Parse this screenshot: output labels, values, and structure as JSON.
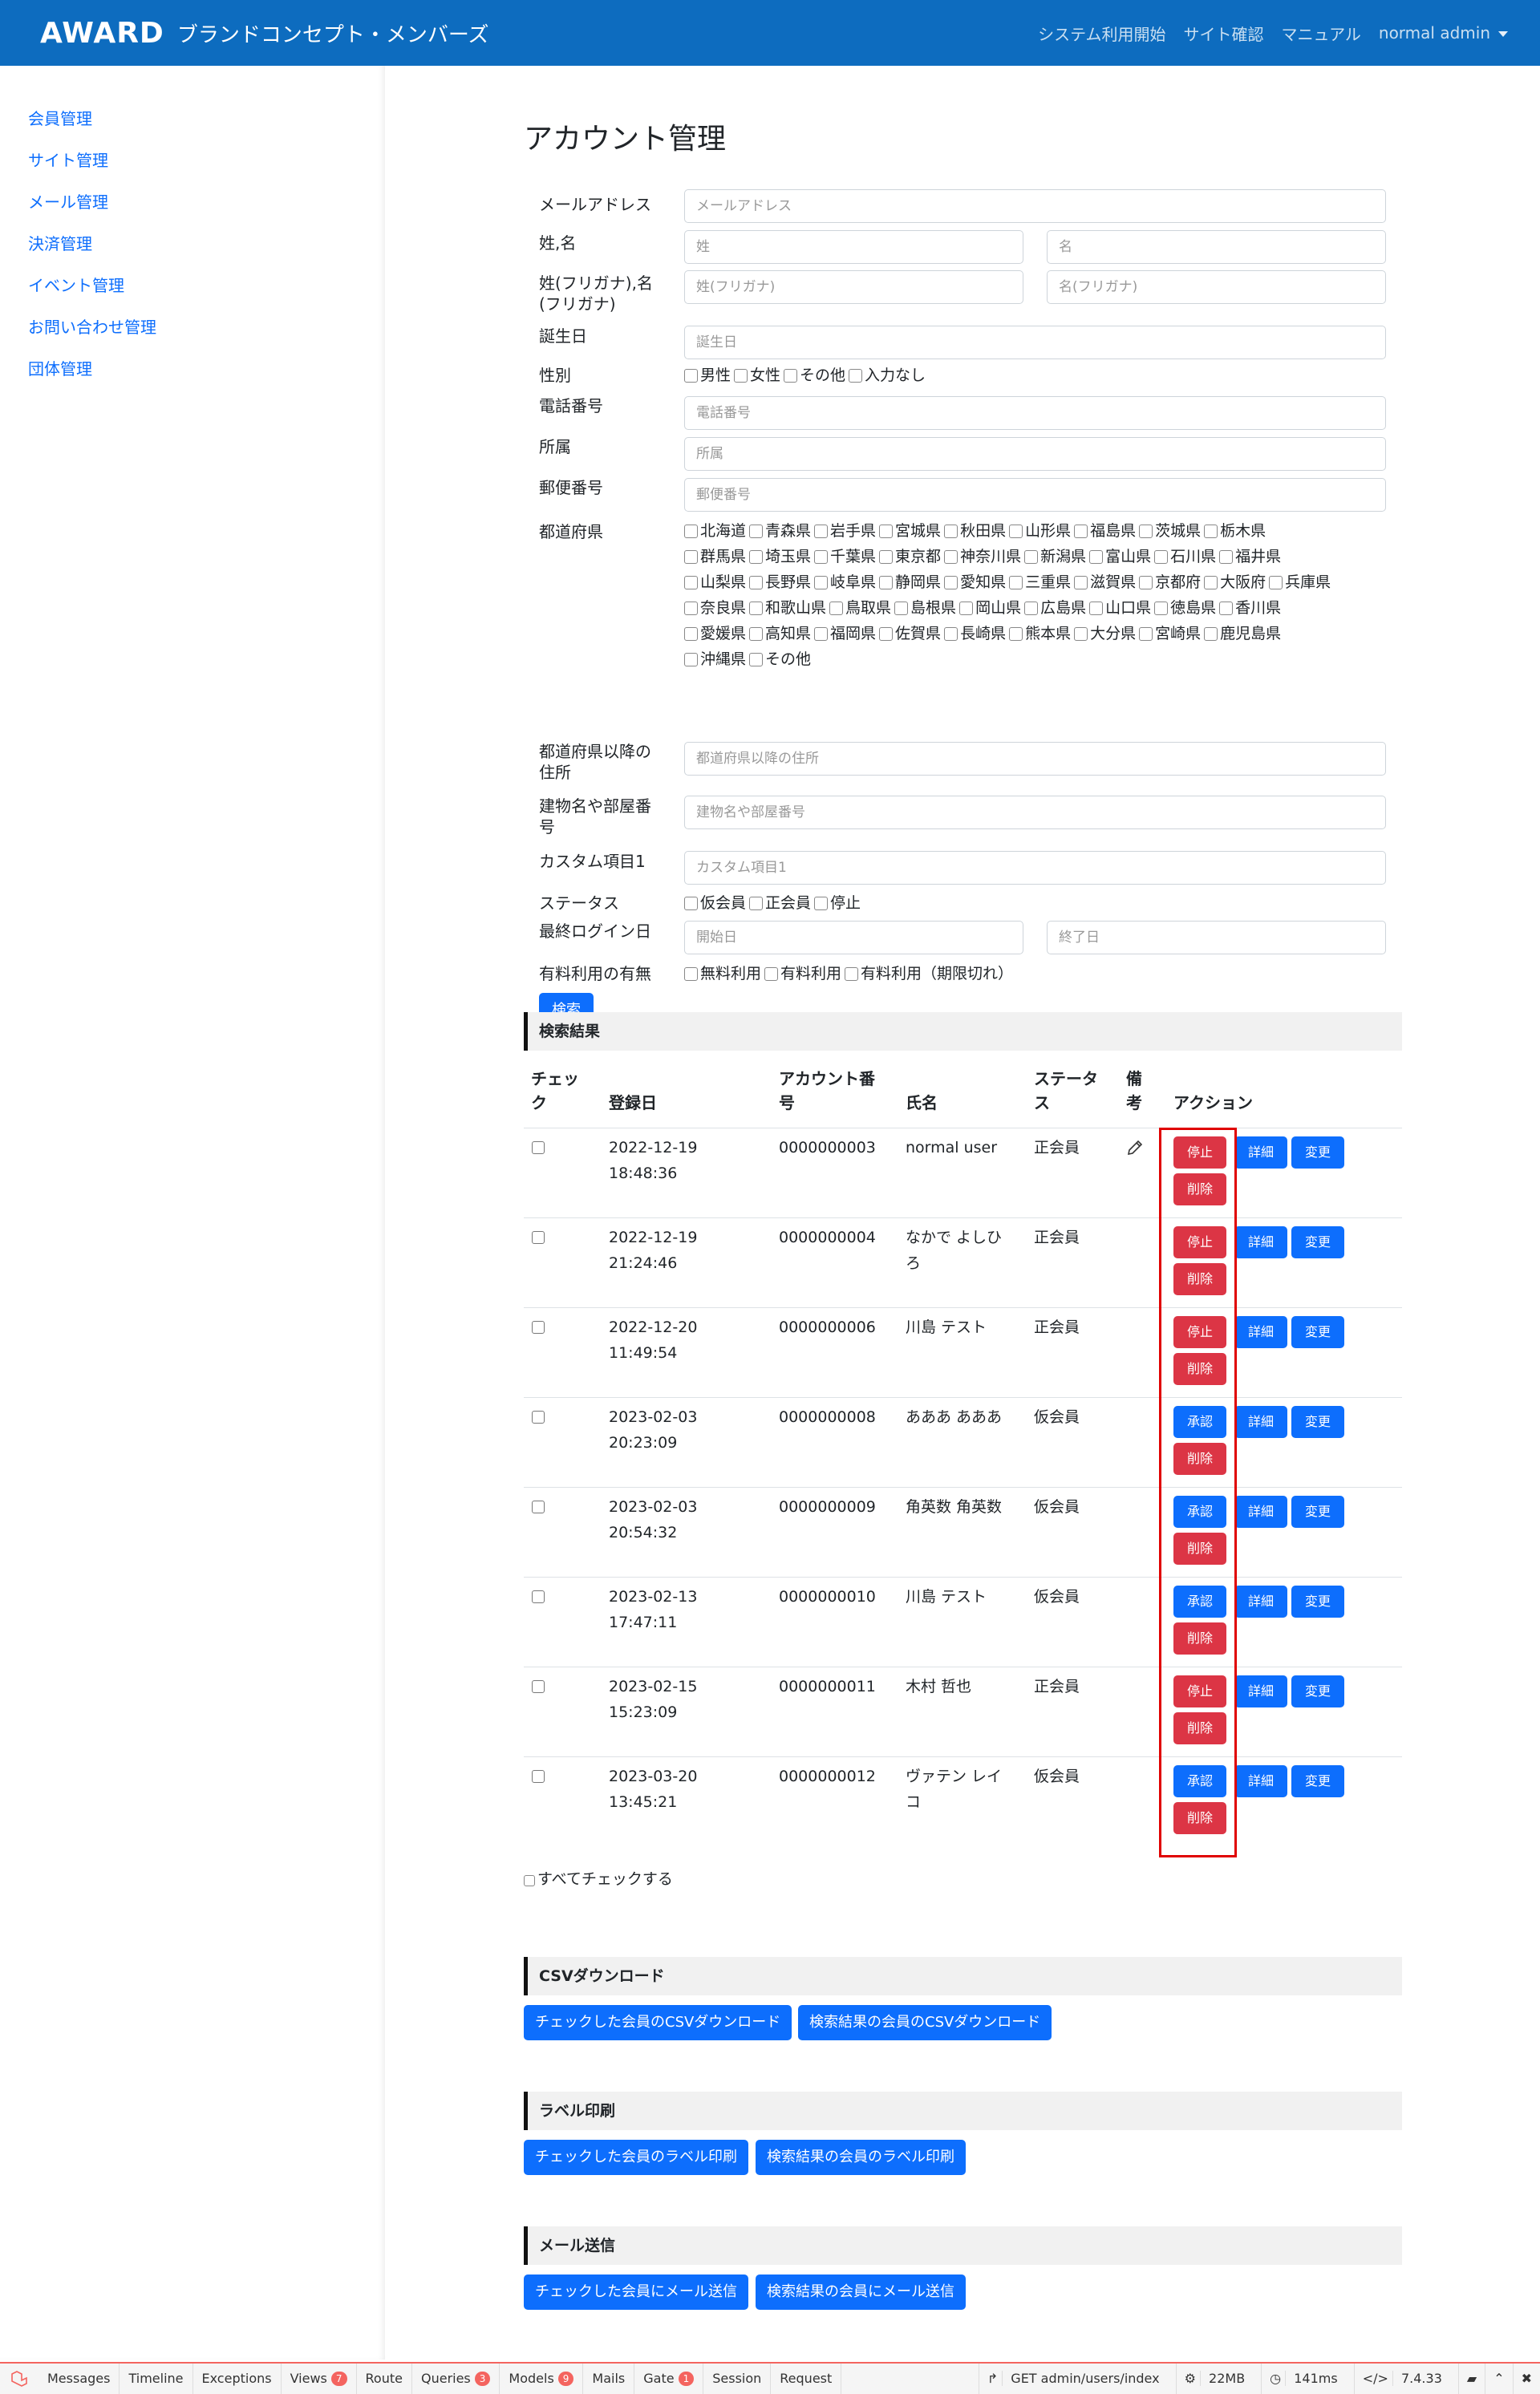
{
  "brand": {
    "logo": "AWARD",
    "subtitle": "ブランドコンセプト・メンバーズ"
  },
  "nav": {
    "links": [
      "システム利用開始",
      "サイト確認",
      "マニュアル"
    ],
    "user": "normal admin"
  },
  "sidebar": {
    "items": [
      "会員管理",
      "サイト管理",
      "メール管理",
      "決済管理",
      "イベント管理",
      "お問い合わせ管理",
      "団体管理"
    ]
  },
  "page": {
    "title": "アカウント管理"
  },
  "form": {
    "email": {
      "label": "メールアドレス",
      "placeholder": "メールアドレス"
    },
    "name": {
      "label": "姓,名",
      "last": "姓",
      "first": "名"
    },
    "kana": {
      "label1": "姓(フリガナ),名",
      "label2": "(フリガナ)",
      "last": "姓(フリガナ)",
      "first": "名(フリガナ)"
    },
    "birthday": {
      "label": "誕生日",
      "placeholder": "誕生日"
    },
    "gender": {
      "label": "性別",
      "options": [
        "男性",
        "女性",
        "その他",
        "入力なし"
      ]
    },
    "phone": {
      "label": "電話番号",
      "placeholder": "電話番号"
    },
    "affiliation": {
      "label": "所属",
      "placeholder": "所属"
    },
    "zip": {
      "label": "郵便番号",
      "placeholder": "郵便番号"
    },
    "pref": {
      "label": "都道府県",
      "rows": [
        [
          "北海道",
          "青森県",
          "岩手県",
          "宮城県",
          "秋田県",
          "山形県",
          "福島県",
          "茨城県",
          "栃木県"
        ],
        [
          "群馬県",
          "埼玉県",
          "千葉県",
          "東京都",
          "神奈川県",
          "新潟県",
          "富山県",
          "石川県",
          "福井県"
        ],
        [
          "山梨県",
          "長野県",
          "岐阜県",
          "静岡県",
          "愛知県",
          "三重県",
          "滋賀県",
          "京都府",
          "大阪府",
          "兵庫県"
        ],
        [
          "奈良県",
          "和歌山県",
          "鳥取県",
          "島根県",
          "岡山県",
          "広島県",
          "山口県",
          "徳島県",
          "香川県"
        ],
        [
          "愛媛県",
          "高知県",
          "福岡県",
          "佐賀県",
          "長崎県",
          "熊本県",
          "大分県",
          "宮崎県",
          "鹿児島県"
        ],
        [
          "沖縄県",
          "その他"
        ]
      ]
    },
    "address": {
      "label1": "都道府県以降の",
      "label2": "住所",
      "placeholder": "都道府県以降の住所"
    },
    "building": {
      "label1": "建物名や部屋番",
      "label2": "号",
      "placeholder": "建物名や部屋番号"
    },
    "custom": {
      "label": "カスタム項目1",
      "placeholder": "カスタム項目1"
    },
    "status": {
      "label": "ステータス",
      "options": [
        "仮会員",
        "正会員",
        "停止"
      ]
    },
    "login": {
      "label": "最終ログイン日",
      "start": "開始日",
      "end": "終了日"
    },
    "paid": {
      "label": "有料利用の有無",
      "options": [
        "無料利用",
        "有料利用",
        "有料利用（期限切れ）"
      ]
    },
    "search_button": "検索"
  },
  "results": {
    "heading": "検索結果",
    "headers": {
      "check1": "チェッ",
      "check2": "ク",
      "date": "登録日",
      "acc1": "アカウント番",
      "acc2": "号",
      "name": "氏名",
      "status1": "ステータ",
      "status2": "ス",
      "note1": "備",
      "note2": "考",
      "action": "アクション"
    },
    "rows": [
      {
        "date1": "2022-12-19",
        "date2": "18:48:36",
        "account": "0000000003",
        "name1": "normal user",
        "name2": "",
        "status": "正会員",
        "toggle": "停止",
        "edit_icon": true
      },
      {
        "date1": "2022-12-19",
        "date2": "21:24:46",
        "account": "0000000004",
        "name1": "なかで よしひ",
        "name2": "ろ",
        "status": "正会員",
        "toggle": "停止",
        "edit_icon": false
      },
      {
        "date1": "2022-12-20",
        "date2": "11:49:54",
        "account": "0000000006",
        "name1": "川島 テスト",
        "name2": "",
        "status": "正会員",
        "toggle": "停止",
        "edit_icon": false
      },
      {
        "date1": "2023-02-03",
        "date2": "20:23:09",
        "account": "0000000008",
        "name1": "あああ あああ",
        "name2": "",
        "status": "仮会員",
        "toggle": "承認",
        "edit_icon": false
      },
      {
        "date1": "2023-02-03",
        "date2": "20:54:32",
        "account": "0000000009",
        "name1": "角英数 角英数",
        "name2": "",
        "status": "仮会員",
        "toggle": "承認",
        "edit_icon": false
      },
      {
        "date1": "2023-02-13",
        "date2": "17:47:11",
        "account": "0000000010",
        "name1": "川島 テスト",
        "name2": "",
        "status": "仮会員",
        "toggle": "承認",
        "edit_icon": false
      },
      {
        "date1": "2023-02-15",
        "date2": "15:23:09",
        "account": "0000000011",
        "name1": "木村 哲也",
        "name2": "",
        "status": "正会員",
        "toggle": "停止",
        "edit_icon": false
      },
      {
        "date1": "2023-03-20",
        "date2": "13:45:21",
        "account": "0000000012",
        "name1": "ヴァテン レイ",
        "name2": "コ",
        "status": "仮会員",
        "toggle": "承認",
        "edit_icon": false
      }
    ],
    "labels": {
      "detail": "詳細",
      "change": "変更",
      "delete": "削除"
    },
    "check_all": "すべてチェックする"
  },
  "csv": {
    "heading": "CSVダウンロード",
    "checked": "チェックした会員のCSVダウンロード",
    "results": "検索結果の会員のCSVダウンロード"
  },
  "label_print": {
    "heading": "ラベル印刷",
    "checked": "チェックした会員のラベル印刷",
    "results": "検索結果の会員のラベル印刷"
  },
  "mail": {
    "heading": "メール送信",
    "checked": "チェックした会員にメール送信",
    "results": "検索結果の会員にメール送信"
  },
  "debugbar": {
    "tabs": [
      {
        "label": "Messages"
      },
      {
        "label": "Timeline"
      },
      {
        "label": "Exceptions"
      },
      {
        "label": "Views",
        "badge": "7"
      },
      {
        "label": "Route"
      },
      {
        "label": "Queries",
        "badge": "3"
      },
      {
        "label": "Models",
        "badge": "9"
      },
      {
        "label": "Mails"
      },
      {
        "label": "Gate",
        "badge": "1"
      },
      {
        "label": "Session"
      },
      {
        "label": "Request"
      }
    ],
    "route": "GET admin/users/index",
    "memory": "22MB",
    "time": "141ms",
    "version": "7.4.33"
  },
  "colors": {
    "primary": "#0d6efd",
    "danger": "#dc3545",
    "navbar": "#0d6cbf",
    "highlight": "#e00000"
  }
}
